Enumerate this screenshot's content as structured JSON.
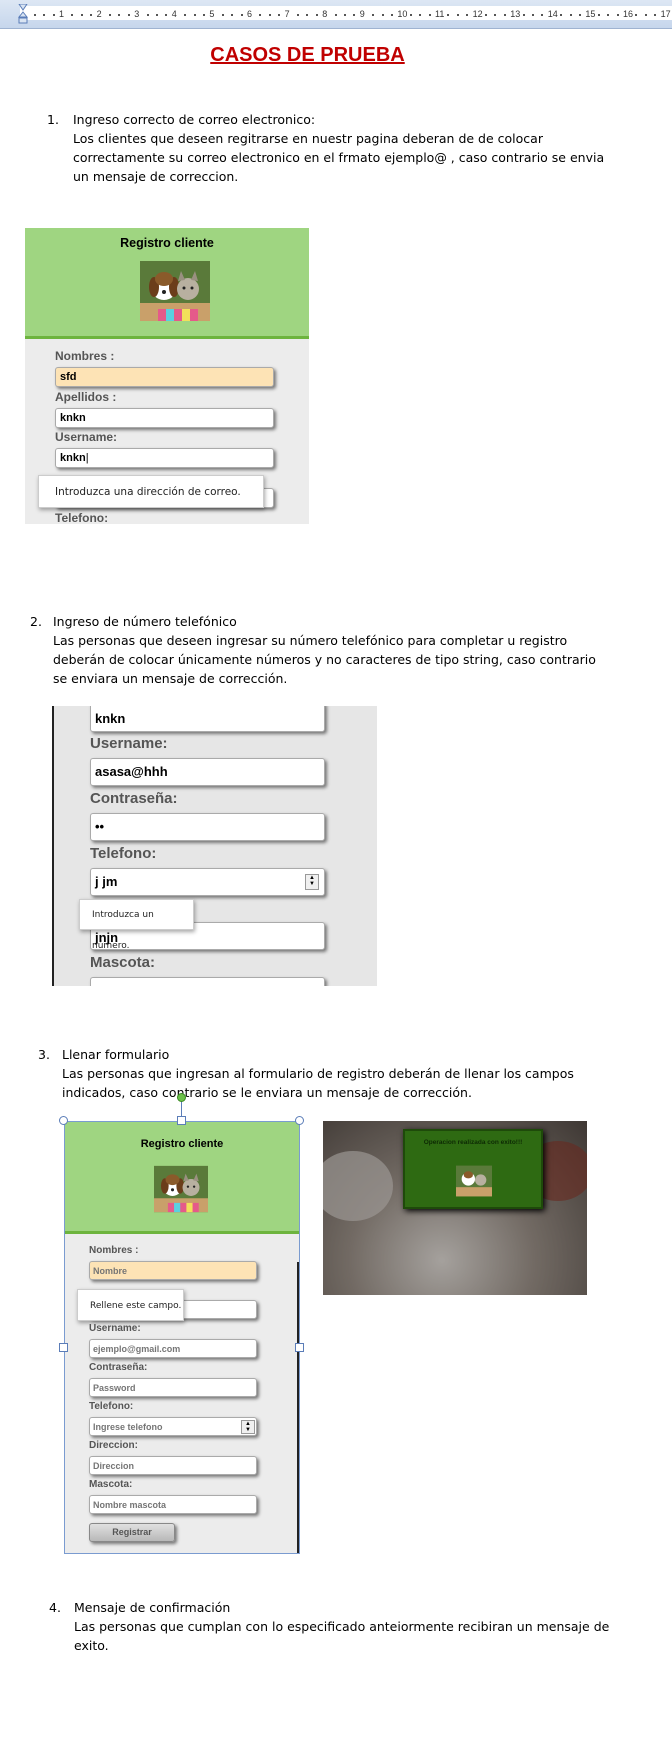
{
  "ruler": {
    "ticks": [
      "1",
      "2",
      "3",
      "4",
      "5",
      "6",
      "7",
      "8",
      "9",
      "10",
      "11",
      "12",
      "13",
      "14",
      "15",
      "16",
      "17"
    ]
  },
  "doc_title": "CASOS DE PRUEBA",
  "cases": [
    {
      "number": "1.",
      "title": "Ingreso correcto de correo electronico:",
      "lines": [
        "Los clientes que deseen regitrarse en nuestr pagina deberan de de colocar",
        "correctamente su correo electronico en el frmato ejemplo@ , caso contrario se envia",
        "un mensaje de correccion."
      ]
    },
    {
      "number": "2.",
      "title": "Ingreso de número telefónico",
      "lines": [
        "Las personas que deseen ingresar su número telefónico para completar u registro",
        "deberán de colocar únicamente números y no caracteres de tipo string, caso contrario",
        "se enviara un mensaje de corrección."
      ]
    },
    {
      "number": "3.",
      "title": "Llenar formulario",
      "lines": [
        "Las personas que ingresan al formulario de registro deberán de llenar los campos",
        "indicados, caso contrario se le enviara un mensaje de corrección."
      ]
    },
    {
      "number": "4.",
      "title": "Mensaje de confirmación",
      "lines": [
        "Las personas que cumplan con lo especificado anteiormente recibiran un mensaje de",
        "exito."
      ]
    }
  ],
  "shot1": {
    "header": "Registro cliente",
    "labels": {
      "nombres": "Nombres :",
      "apellidos": "Apellidos :",
      "username": "Username:",
      "telefono": "Telefono:"
    },
    "values": {
      "nombres": "sfd",
      "apellidos": "knkn",
      "username": "knkn"
    },
    "tooltip": "Introduzca una dirección de correo."
  },
  "shot2": {
    "labels": {
      "username": "Username:",
      "contrasena": "Contraseña:",
      "telefono": "Telefono:",
      "mascota": "Mascota:"
    },
    "values": {
      "top": "knkn",
      "username": "asasa@hhh",
      "contrasena": "••",
      "telefono": "j jm",
      "direccion": "jnjn"
    },
    "tooltip": "Introduzca un número."
  },
  "shot3": {
    "header": "Registro cliente",
    "labels": {
      "nombres": "Nombres :",
      "username": "Username:",
      "contrasena": "Contraseña:",
      "telefono": "Telefono:",
      "direccion": "Direccion:",
      "mascota": "Mascota:"
    },
    "placeholders": {
      "nombres": "Nombre",
      "username": "ejemplo@gmail.com",
      "contrasena": "Password",
      "telefono": "Ingrese telefono",
      "direccion": "Direccion",
      "mascota": "Nombre mascota"
    },
    "tooltip": "Rellene este campo.",
    "button": "Registrar"
  },
  "shot4": {
    "message": "Operacion realizada con exito!!!"
  },
  "colors": {
    "title_red": "#c00000",
    "header_green": "#9fd581",
    "highlight": "#fde3b5",
    "success_green": "#2e6a12"
  }
}
